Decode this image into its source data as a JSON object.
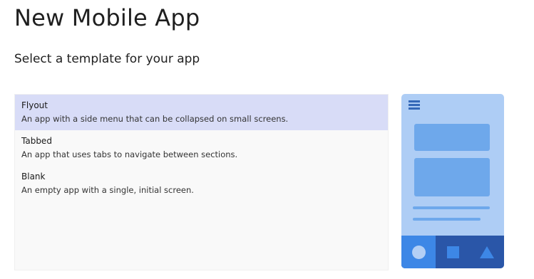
{
  "header": {
    "title": "New Mobile App",
    "subtitle": "Select a template for your app"
  },
  "templates": [
    {
      "name": "Flyout",
      "description": "An app with a side menu that can be collapsed on small screens.",
      "selected": true
    },
    {
      "name": "Tabbed",
      "description": "An app that uses tabs to navigate between sections.",
      "selected": false
    },
    {
      "name": "Blank",
      "description": "An empty app with a single, initial screen.",
      "selected": false
    }
  ],
  "preview": {
    "menu_icon": "hamburger-menu-icon",
    "tab_icons": [
      "circle-tab-icon",
      "square-tab-icon",
      "triangle-tab-icon"
    ],
    "active_tab_index": 0,
    "colors": {
      "background": "#aecdf5",
      "cards": "#6ea8eb",
      "tabbar": "#2a56a8",
      "active_tab": "#3d87e6",
      "selection": "#d8dcf7"
    }
  }
}
